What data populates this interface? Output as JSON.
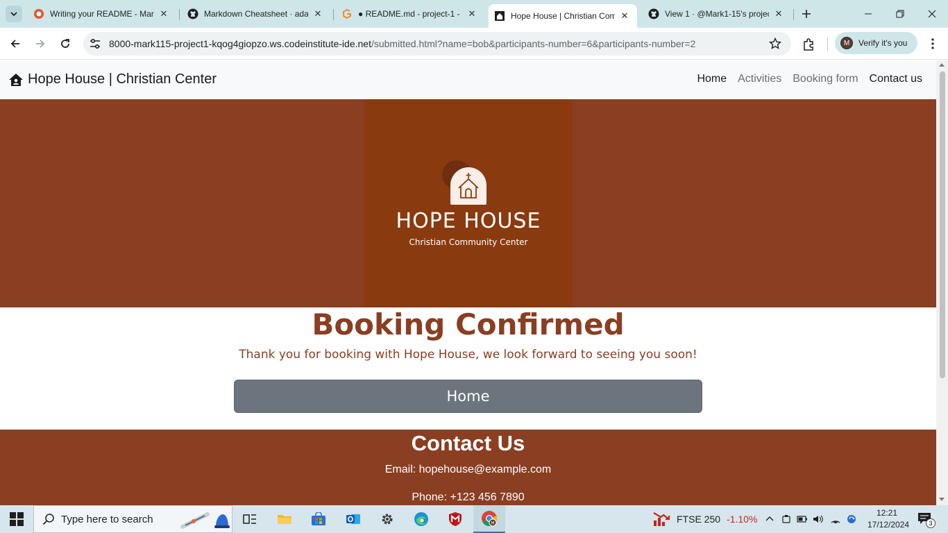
{
  "browser": {
    "tabs": [
      {
        "title": "Writing your README - Mar",
        "icon": "codeinstitute-favicon"
      },
      {
        "title": "Markdown Cheatsheet · ada",
        "icon": "github-favicon"
      },
      {
        "title": "● README.md - project-1 -",
        "icon": "gitpod-favicon"
      },
      {
        "title": "Hope House | Christian Com",
        "icon": "site-favicon"
      },
      {
        "title": "View 1 · @Mark1-15's projec",
        "icon": "github-favicon"
      }
    ],
    "active_tab": 3,
    "url_host": "8000-mark115-project1-kqog4giopzo.ws.codeinstitute-ide.net",
    "url_rest": "/submitted.html?name=bob&participants-number=6&participants-number=2",
    "verify_label": "Verify it's you",
    "avatar_letter": "M"
  },
  "site": {
    "brand": "Hope House | Christian Center",
    "nav": [
      {
        "label": "Home",
        "muted": false
      },
      {
        "label": "Activities",
        "muted": true
      },
      {
        "label": "Booking form",
        "muted": true
      },
      {
        "label": "Contact us",
        "muted": false
      }
    ],
    "logo_title": "HOPE HOUSE",
    "logo_subtitle": "Christian Community Center",
    "heading": "Booking Confirmed",
    "message": "Thank you for booking with Hope House, we look forward to seeing you soon!",
    "home_button": "Home",
    "footer": {
      "title": "Contact Us",
      "email": "Email: hopehouse@example.com",
      "phone": "Phone: +123 456 7890"
    },
    "colors": {
      "brand_brown": "#8a3e22",
      "button_gray": "#6c757d"
    }
  },
  "taskbar": {
    "search_placeholder": "Type here to search",
    "ftse_label": "FTSE 250",
    "ftse_change": "-1.10%",
    "time": "12:21",
    "date": "17/12/2024",
    "notification_count": "3"
  }
}
